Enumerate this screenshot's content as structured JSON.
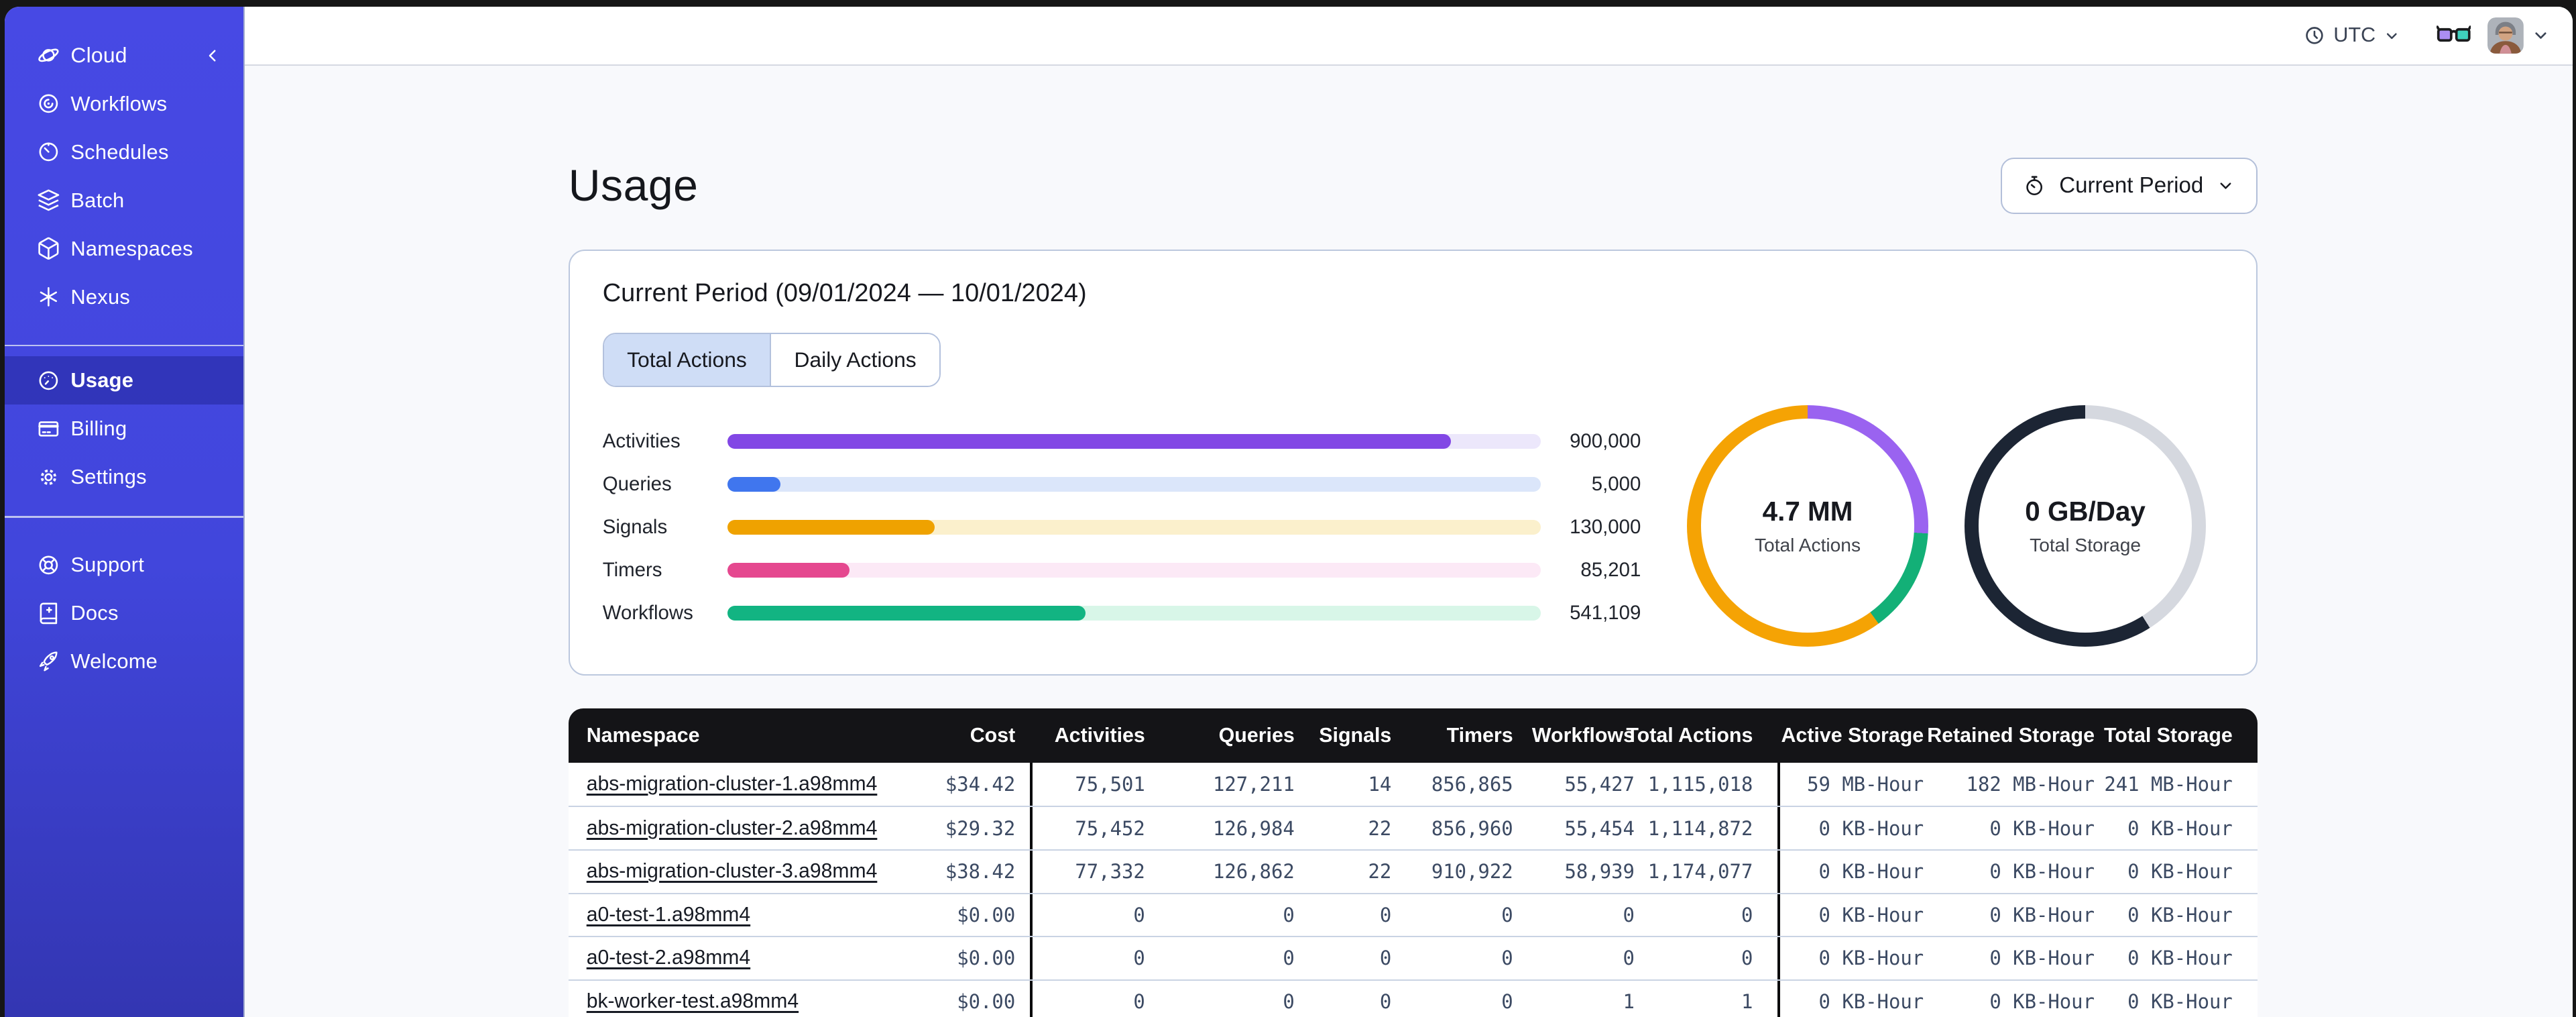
{
  "topbar": {
    "timezone_label": "UTC"
  },
  "sidebar": {
    "brand_label": "Cloud",
    "nav_items": [
      "Workflows",
      "Schedules",
      "Batch",
      "Namespaces",
      "Nexus"
    ],
    "account_items": [
      "Usage",
      "Billing",
      "Settings"
    ],
    "footer_items": [
      "Support",
      "Docs",
      "Welcome"
    ],
    "active_item": "Usage"
  },
  "page": {
    "title": "Usage",
    "period_selector_label": "Current Period"
  },
  "usage_card": {
    "title": "Current Period (09/01/2024 — 10/01/2024)",
    "tabs": [
      {
        "label": "Total Actions",
        "active": true
      },
      {
        "label": "Daily Actions",
        "active": false
      }
    ],
    "bars": [
      {
        "label": "Activities",
        "value": "900,000",
        "pct": 89,
        "fill": "#8247e5",
        "track": "#ece7fb"
      },
      {
        "label": "Queries",
        "value": "5,000",
        "pct": 6.5,
        "fill": "#4076ee",
        "track": "#dbe6fa"
      },
      {
        "label": "Signals",
        "value": "130,000",
        "pct": 25.5,
        "fill": "#efa200",
        "track": "#fbf0cc"
      },
      {
        "label": "Timers",
        "value": "85,201",
        "pct": 15,
        "fill": "#e5488f",
        "track": "#fce9f6"
      },
      {
        "label": "Workflows",
        "value": "541,109",
        "pct": 44,
        "fill": "#12b482",
        "track": "#d8f6e8"
      }
    ],
    "donuts": [
      {
        "value": "4.7 MM",
        "label": "Total Actions",
        "segments": [
          {
            "color": "#9a63f0",
            "pct": 26
          },
          {
            "color": "#13b077",
            "pct": 14
          },
          {
            "color": "#f5a304",
            "pct": 60
          }
        ]
      },
      {
        "value": "0 GB/Day",
        "label": "Total Storage",
        "segments": [
          {
            "color": "#d5d8df",
            "pct": 41
          },
          {
            "color": "#1c2534",
            "pct": 59
          }
        ]
      }
    ]
  },
  "table": {
    "columns": [
      "Namespace",
      "Cost",
      "Activities",
      "Queries",
      "Signals",
      "Timers",
      "Workflows",
      "Total Actions",
      "Active Storage",
      "Retained Storage",
      "Total Storage"
    ],
    "rows": [
      {
        "namespace": "abs-migration-cluster-1.a98mm4",
        "cost": "$34.42",
        "metrics": [
          "75,501",
          "127,211",
          "14",
          "856,865",
          "55,427",
          "1,115,018"
        ],
        "storage": [
          "59 MB-Hour",
          "182 MB-Hour",
          "241 MB-Hour"
        ]
      },
      {
        "namespace": "abs-migration-cluster-2.a98mm4",
        "cost": "$29.32",
        "metrics": [
          "75,452",
          "126,984",
          "22",
          "856,960",
          "55,454",
          "1,114,872"
        ],
        "storage": [
          "0 KB-Hour",
          "0 KB-Hour",
          "0 KB-Hour"
        ]
      },
      {
        "namespace": "abs-migration-cluster-3.a98mm4",
        "cost": "$38.42",
        "metrics": [
          "77,332",
          "126,862",
          "22",
          "910,922",
          "58,939",
          "1,174,077"
        ],
        "storage": [
          "0 KB-Hour",
          "0 KB-Hour",
          "0 KB-Hour"
        ]
      },
      {
        "namespace": "a0-test-1.a98mm4",
        "cost": "$0.00",
        "metrics": [
          "0",
          "0",
          "0",
          "0",
          "0",
          "0"
        ],
        "storage": [
          "0 KB-Hour",
          "0 KB-Hour",
          "0 KB-Hour"
        ]
      },
      {
        "namespace": "a0-test-2.a98mm4",
        "cost": "$0.00",
        "metrics": [
          "0",
          "0",
          "0",
          "0",
          "0",
          "0"
        ],
        "storage": [
          "0 KB-Hour",
          "0 KB-Hour",
          "0 KB-Hour"
        ]
      },
      {
        "namespace": "bk-worker-test.a98mm4",
        "cost": "$0.00",
        "metrics": [
          "0",
          "0",
          "0",
          "0",
          "1",
          "1"
        ],
        "storage": [
          "0 KB-Hour",
          "0 KB-Hour",
          "0 KB-Hour"
        ]
      }
    ]
  }
}
